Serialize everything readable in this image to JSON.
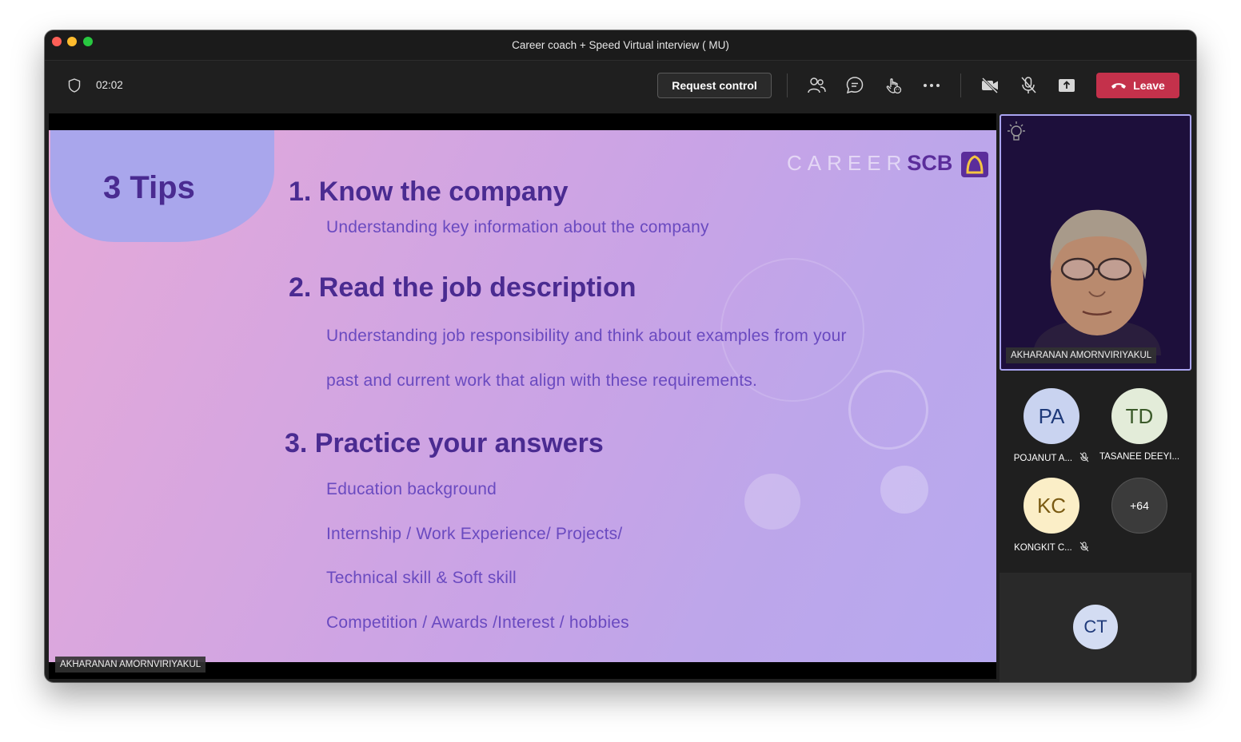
{
  "window": {
    "title": "Career coach + Speed Virtual interview ( MU)"
  },
  "toolbar": {
    "timer": "02:02",
    "request_control": "Request control",
    "leave": "Leave",
    "leave_color": "#c4314b"
  },
  "slide": {
    "title": "3 Tips",
    "brand_career": "CAREER",
    "brand_scb": "SCB",
    "sections": [
      {
        "heading": "1. Know the company",
        "lines": [
          "Understanding key information about the company"
        ]
      },
      {
        "heading": "2. Read the job description",
        "lines": [
          "Understanding job responsibility and think about examples from your",
          "past and current work that align with these requirements."
        ]
      },
      {
        "heading": "3. Practice your answers",
        "lines": [
          "Education background",
          "Internship / Work Experience/ Projects/",
          "Technical skill & Soft skill",
          "Competition / Awards /Interest / hobbies"
        ]
      }
    ]
  },
  "presenter": {
    "name": "AKHARANAN AMORNVIRIYAKUL"
  },
  "spotlight": {
    "name": "AKHARANAN AMORNVIRIYAKUL"
  },
  "participants": [
    {
      "initials": "PA",
      "name": "POJANUT A...",
      "muted": true,
      "color": "#c9d3f0",
      "text_color": "#1f3a7a"
    },
    {
      "initials": "TD",
      "name": "TASANEE DEEYI...",
      "muted": false,
      "color": "#e3ecd9",
      "text_color": "#3b5a2a"
    },
    {
      "initials": "KC",
      "name": "KONGKIT C...",
      "muted": true,
      "color": "#fbeec7",
      "text_color": "#7a5a12"
    },
    {
      "initials": "+64",
      "name": "",
      "muted": false,
      "color": "#3b3b3b",
      "text_color": "#ffffff"
    }
  ],
  "bottom_tile": {
    "initials": "CT",
    "color": "#d3dcf2",
    "text_color": "#1f3a7a"
  },
  "icons": [
    "shield-icon",
    "participants-icon",
    "chat-icon",
    "reactions-icon",
    "more-icon",
    "camera-off-icon",
    "mic-off-icon",
    "share-icon",
    "phone-icon",
    "lightbulb-icon"
  ]
}
